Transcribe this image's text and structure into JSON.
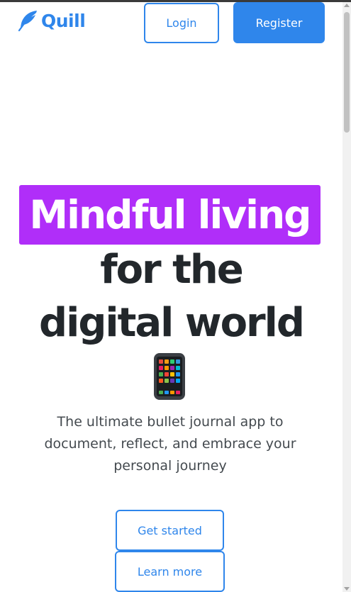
{
  "nav": {
    "brand": "Quill",
    "login_label": "Login",
    "register_label": "Register"
  },
  "hero": {
    "highlight": "Mindful living",
    "line2": "for the",
    "line3": "digital world",
    "emoji_icon": "mobile-phone-icon",
    "subtitle": "The ultimate bullet journal app to document, reflect, and embrace your personal journey"
  },
  "cta": {
    "get_started_label": "Get started",
    "learn_more_label": "Learn more"
  },
  "colors": {
    "accent": "#2f86eb",
    "highlight": "#b02ef9",
    "heading": "#22272b"
  }
}
